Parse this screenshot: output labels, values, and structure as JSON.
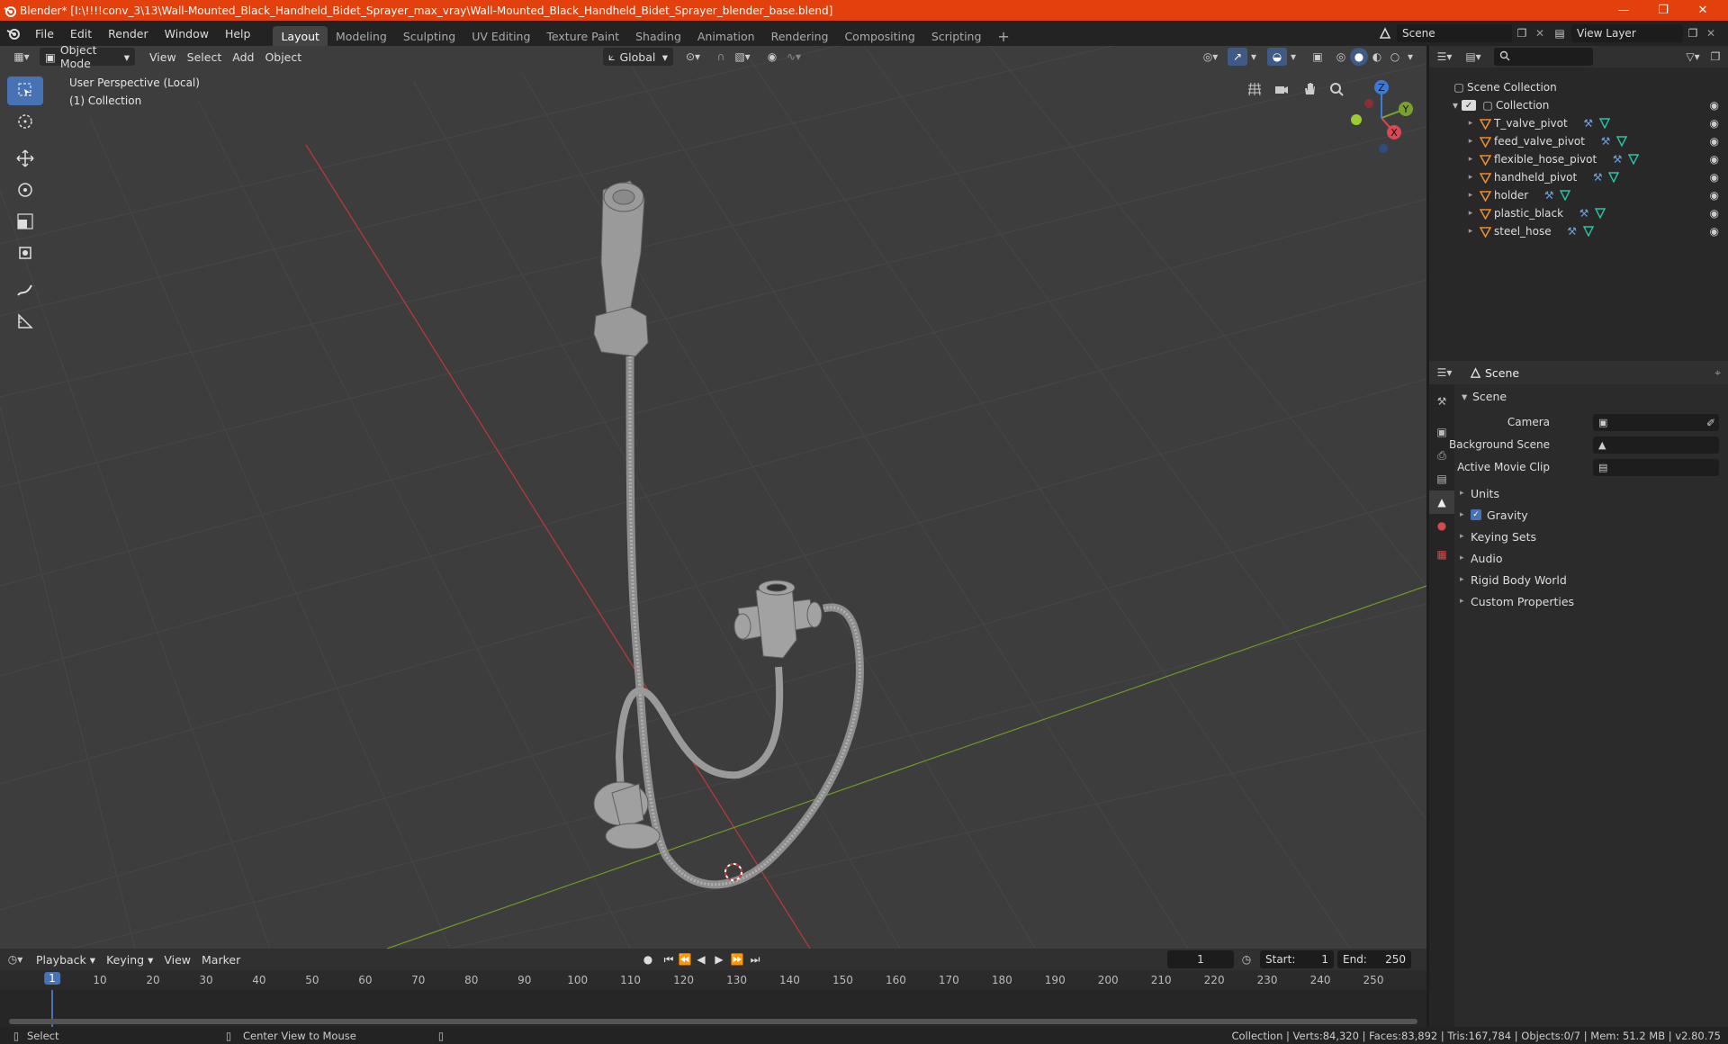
{
  "window": {
    "title": "Blender* [I:\\!!!!conv_3\\13\\Wall-Mounted_Black_Handheld_Bidet_Sprayer_max_vray\\Wall-Mounted_Black_Handheld_Bidet_Sprayer_blender_base.blend]"
  },
  "menus": [
    "File",
    "Edit",
    "Render",
    "Window",
    "Help"
  ],
  "workspaces": [
    "Layout",
    "Modeling",
    "Sculpting",
    "UV Editing",
    "Texture Paint",
    "Shading",
    "Animation",
    "Rendering",
    "Compositing",
    "Scripting"
  ],
  "active_workspace": "Layout",
  "scene_selector": {
    "value": "Scene"
  },
  "view_layer_selector": {
    "value": "View Layer"
  },
  "viewport": {
    "mode": "Object Mode",
    "menus": [
      "View",
      "Select",
      "Add",
      "Object"
    ],
    "transform_orientation": "Global",
    "overlay_text": {
      "line1": "User Perspective (Local)",
      "line2": "(1) Collection"
    },
    "gizmo": {
      "z": "Z",
      "y": "Y",
      "x": "X"
    }
  },
  "outliner": {
    "root": "Scene Collection",
    "collection": "Collection",
    "objects": [
      "T_valve_pivot",
      "feed_valve_pivot",
      "flexible_hose_pivot",
      "handheld_pivot",
      "holder",
      "plastic_black",
      "steel_hose"
    ]
  },
  "properties": {
    "header": "Scene",
    "section": "Scene",
    "fields": [
      {
        "label": "Camera",
        "value": ""
      },
      {
        "label": "Background Scene",
        "value": ""
      },
      {
        "label": "Active Movie Clip",
        "value": ""
      }
    ],
    "panels": [
      "Units",
      "Gravity",
      "Keying Sets",
      "Audio",
      "Rigid Body World",
      "Custom Properties"
    ]
  },
  "timeline": {
    "menus": [
      "Playback",
      "Keying",
      "View",
      "Marker"
    ],
    "current_frame": "1",
    "start_label": "Start:",
    "start": "1",
    "end_label": "End:",
    "end": "250",
    "ticks": [
      "1",
      "10",
      "20",
      "30",
      "40",
      "50",
      "60",
      "70",
      "80",
      "90",
      "100",
      "110",
      "120",
      "130",
      "140",
      "150",
      "160",
      "170",
      "180",
      "190",
      "200",
      "210",
      "220",
      "230",
      "240",
      "250"
    ]
  },
  "statusbar": {
    "left1": "Select",
    "left2": "Center View to Mouse",
    "right": "Collection | Verts:84,320 | Faces:83,892 | Tris:167,784 | Objects:0/7 | Mem: 51.2 MB | v2.80.75"
  },
  "colors": {
    "accent": "#4772b3",
    "titlebar": "#e2410e",
    "object_orange": "#e88a2e"
  }
}
